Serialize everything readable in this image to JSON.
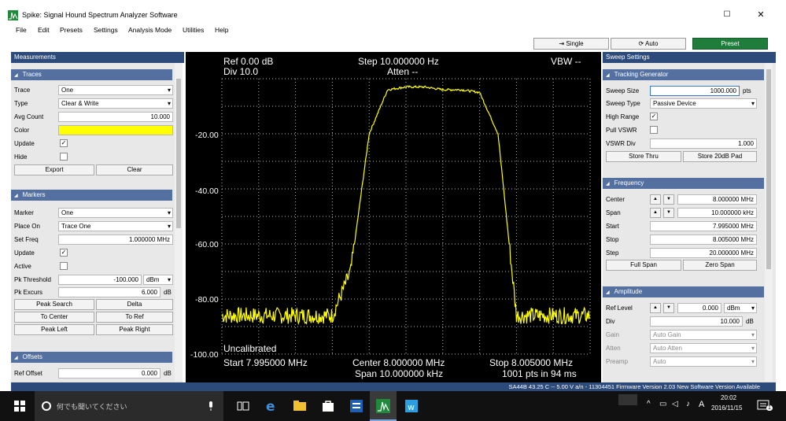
{
  "window": {
    "title": "Spike: Signal Hound Spectrum Analyzer Software",
    "min_glyph": "☐",
    "close_glyph": "✕"
  },
  "menu": [
    "File",
    "Edit",
    "Presets",
    "Settings",
    "Analysis Mode",
    "Utilities",
    "Help"
  ],
  "toolbar": {
    "single": "⇥ Single",
    "auto": "⟳ Auto",
    "preset": "Preset"
  },
  "left": {
    "header": "Measurements",
    "traces": {
      "title": "Traces",
      "trace_label": "Trace",
      "trace_value": "One",
      "type_label": "Type",
      "type_value": "Clear & Write",
      "avg_label": "Avg Count",
      "avg_value": "10.000",
      "color_label": "Color",
      "update_label": "Update",
      "hide_label": "Hide",
      "export_btn": "Export",
      "clear_btn": "Clear"
    },
    "markers": {
      "title": "Markers",
      "marker_label": "Marker",
      "marker_value": "One",
      "place_label": "Place On",
      "place_value": "Trace One",
      "setfreq_label": "Set Freq",
      "setfreq_value": "1.000000 MHz",
      "update_label": "Update",
      "active_label": "Active",
      "pkthr_label": "Pk Threshold",
      "pkthr_value": "-100.000",
      "pkthr_unit": "dBm",
      "pkexc_label": "Pk Excurs",
      "pkexc_value": "6.000",
      "pkexc_unit": "dB",
      "peak_search": "Peak Search",
      "delta": "Delta",
      "to_center": "To Center",
      "to_ref": "To Ref",
      "peak_left": "Peak Left",
      "peak_right": "Peak Right"
    },
    "offsets": {
      "title": "Offsets",
      "refoff_label": "Ref Offset",
      "refoff_value": "0.000",
      "refoff_unit": "dB"
    }
  },
  "plot": {
    "ref": "Ref 0.00 dB",
    "div": "Div 10.0",
    "step": "Step 10.000000 Hz",
    "atten": "Atten --",
    "vbw": "VBW --",
    "uncal": "Uncalibrated",
    "start": "Start 7.995000 MHz",
    "center": "Center 8.000000 MHz",
    "span": "Span 10.000000 kHz",
    "stop": "Stop 8.005000 MHz",
    "pts": "1001 pts in 94 ms",
    "yticks": [
      "-20.00",
      "-40.00",
      "-60.00",
      "-80.00",
      "-100.00"
    ]
  },
  "chart_data": {
    "type": "line",
    "x_unit": "MHz",
    "xlim": [
      7.995,
      8.005
    ],
    "ylim": [
      -100,
      0
    ],
    "grid": true,
    "series": [
      {
        "color": "#ffff00",
        "x": [
          7.995,
          7.996,
          7.997,
          7.9975,
          7.998,
          7.9985,
          7.999,
          7.9995,
          8.0,
          8.0005,
          8.001,
          8.0015,
          8.002,
          8.0025,
          8.003,
          8.0035,
          8.004,
          8.005
        ],
        "y": [
          -86,
          -86,
          -86,
          -86,
          -86,
          -70,
          -20,
          -4,
          -3,
          -3,
          -4,
          -4,
          -5,
          -20,
          -86,
          -86,
          -86,
          -86
        ]
      }
    ]
  },
  "right": {
    "header": "Sweep Settings",
    "tracking": {
      "title": "Tracking Generator",
      "sweep_label": "Sweep Size",
      "sweep_value": "1000.000",
      "sweep_unit": "pts",
      "type_label": "Sweep Type",
      "type_value": "Passive Device",
      "high_label": "High Range",
      "vswr_label": "Pull VSWR",
      "vdiv_label": "VSWR Div",
      "vdiv_value": "1.000",
      "store_thru": "Store Thru",
      "store_pad": "Store 20dB Pad"
    },
    "frequency": {
      "title": "Frequency",
      "center_label": "Center",
      "center_value": "8.000000 MHz",
      "span_label": "Span",
      "span_value": "10.000000 kHz",
      "start_label": "Start",
      "start_value": "7.995000 MHz",
      "stop_label": "Stop",
      "stop_value": "8.005000 MHz",
      "step_label": "Step",
      "step_value": "20.000000 MHz",
      "full_span": "Full Span",
      "zero_span": "Zero Span"
    },
    "amplitude": {
      "title": "Amplitude",
      "ref_label": "Ref Level",
      "ref_value": "0.000",
      "ref_unit": "dBm",
      "div_label": "Div",
      "div_value": "10.000",
      "div_unit": "dB",
      "gain_label": "Gain",
      "gain_value": "Auto Gain",
      "atten_label": "Atten",
      "atten_value": "Auto Atten",
      "preamp_label": "Preamp",
      "preamp_value": "Auto"
    }
  },
  "status": "SA44B  43.25 C -- 5.00 V a/n - 11304451   Firmware Version 2.03   New Software Version Available",
  "taskbar": {
    "search_placeholder": "何でも聞いてください",
    "ime": "A",
    "time": "20:02",
    "date": "2016/11/15",
    "notification_badge": "1"
  },
  "colors": {
    "trace": "#ffff00",
    "panel_header": "#2c4a7a",
    "section_header": "#5470a0",
    "preset": "#1e7d3a"
  }
}
